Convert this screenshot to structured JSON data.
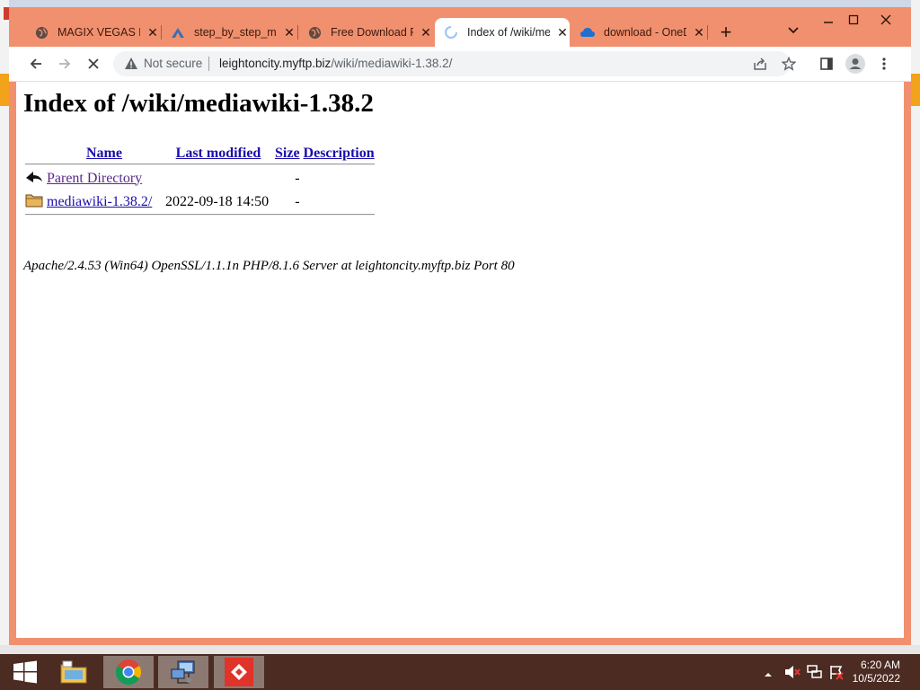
{
  "tabs": [
    {
      "title": "MAGIX VEGAS Pro",
      "icon": "globe-icon",
      "active": false
    },
    {
      "title": "step_by_step_mediawiki",
      "icon": "mediawiki-icon",
      "active": false
    },
    {
      "title": "Free Download PHP",
      "icon": "globe-icon",
      "active": false
    },
    {
      "title": "Index of /wiki/mediawiki",
      "icon": "loading-spinner-icon",
      "active": true
    },
    {
      "title": "download - OneDrive",
      "icon": "onedrive-icon",
      "active": false
    }
  ],
  "omnibox": {
    "security_label": "Not secure",
    "host": "leightoncity.myftp.biz",
    "path": "/wiki/mediawiki-1.38.2/"
  },
  "page": {
    "heading": "Index of /wiki/mediawiki-1.38.2",
    "columns": {
      "name": "Name",
      "last_modified": "Last modified",
      "size": "Size",
      "description": "Description"
    },
    "rows": [
      {
        "name": "Parent Directory",
        "last_modified": "",
        "size": "-",
        "description": "",
        "icon": "back-arrow-icon"
      },
      {
        "name": "mediawiki-1.38.2/",
        "last_modified": "2022-09-18 14:50",
        "size": "-",
        "description": "",
        "icon": "folder-icon"
      }
    ],
    "server_signature": "Apache/2.4.53 (Win64) OpenSSL/1.1.1n PHP/8.1.6 Server at leightoncity.myftp.biz Port 80"
  },
  "taskbar": {
    "items": [
      "start-button",
      "file-explorer",
      "chrome",
      "network-app",
      "anydesk"
    ],
    "time": "6:20 AM",
    "date": "10/5/2022"
  },
  "colors": {
    "frame": "#f1906e",
    "taskbar": "#4b2b22",
    "link": "#1a0dab",
    "visited_link": "#5a2a8a"
  }
}
